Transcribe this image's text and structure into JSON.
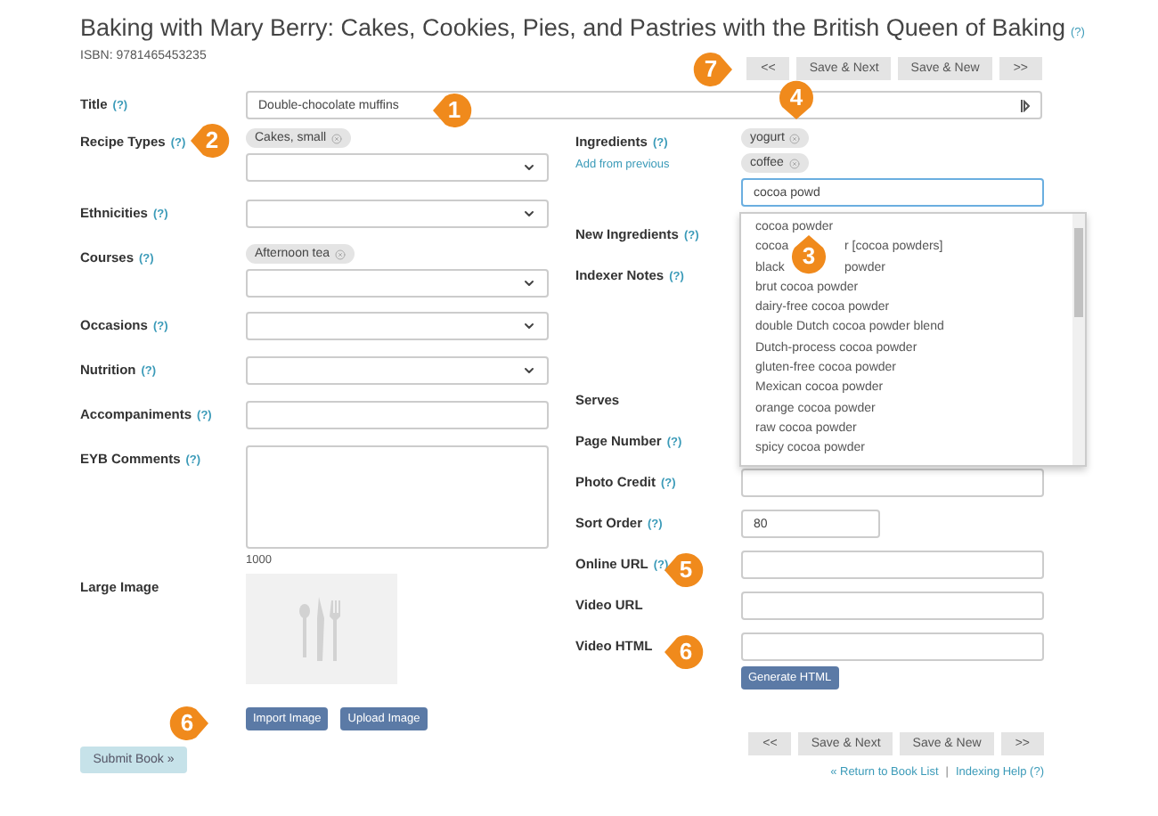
{
  "book": {
    "title": "Baking with Mary Berry: Cakes, Cookies, Pies, and Pastries with the British Queen of Baking",
    "help": "(?)",
    "isbn": "ISBN: 9781465453235"
  },
  "nav_top": [
    "<<",
    "Save & Next",
    "Save & New",
    ">>"
  ],
  "title_field": {
    "label": "Title",
    "help": "(?)",
    "value": "Double-chocolate muffins"
  },
  "left_fields": [
    {
      "kind": "select",
      "label": "Recipe Types",
      "help": "(?)",
      "tags": [
        "Cakes, small"
      ]
    },
    {
      "kind": "select",
      "label": "Ethnicities",
      "help": "(?)"
    },
    {
      "kind": "select",
      "label": "Courses",
      "help": "(?)",
      "tags": [
        "Afternoon tea"
      ]
    },
    {
      "kind": "select",
      "label": "Occasions",
      "help": "(?)"
    },
    {
      "kind": "select",
      "label": "Nutrition",
      "help": "(?)"
    },
    {
      "kind": "text",
      "label": "Accompaniments",
      "help": "(?)"
    },
    {
      "kind": "textarea",
      "label": "EYB Comments",
      "help": "(?)",
      "counter": "1000"
    },
    {
      "kind": "image",
      "label": "Large Image",
      "buttons": [
        "Import Image",
        "Upload Image"
      ]
    }
  ],
  "submit": "Submit Book »",
  "right_fields": [
    {
      "kind": "tags-input",
      "label": "Ingredients",
      "help": "(?)",
      "link": "Add from previous",
      "tags": [
        "yogurt",
        "coffee"
      ],
      "value": "cocoa powd"
    },
    {
      "kind": "covered",
      "label": "New Ingredients",
      "help": "(?)"
    },
    {
      "kind": "covered-tall",
      "label": "Indexer Notes",
      "help": "(?)"
    },
    {
      "kind": "covered",
      "label": "Serves"
    },
    {
      "kind": "covered",
      "label": "Page Number",
      "help": "(?)"
    },
    {
      "kind": "text",
      "label": "Photo Credit",
      "help": "(?)"
    },
    {
      "kind": "short",
      "label": "Sort Order",
      "help": "(?)",
      "value": "80"
    },
    {
      "kind": "text",
      "label": "Online URL",
      "help": "(?)"
    },
    {
      "kind": "text",
      "label": "Video URL"
    },
    {
      "kind": "text",
      "label": "Video HTML",
      "button": "Generate HTML"
    }
  ],
  "suggestions": [
    {
      "parts": [
        "cocoa powder"
      ]
    },
    {
      "parts": [
        "cocoa",
        "r [cocoa powders]"
      ]
    },
    {
      "parts": [
        "black",
        "powder"
      ]
    },
    {
      "parts": [
        "brut cocoa powder"
      ]
    },
    {
      "parts": [
        "dairy-free cocoa powder"
      ]
    },
    {
      "parts": [
        "double Dutch cocoa powder blend"
      ]
    },
    {
      "parts": [
        "Dutch-process cocoa powder"
      ]
    },
    {
      "parts": [
        "gluten-free cocoa powder"
      ]
    },
    {
      "parts": [
        "Mexican cocoa powder"
      ]
    },
    {
      "parts": [
        "orange cocoa powder"
      ]
    },
    {
      "parts": [
        "raw cocoa powder"
      ]
    },
    {
      "parts": [
        "spicy cocoa powder"
      ]
    }
  ],
  "nav_bottom": [
    "<<",
    "Save & Next",
    "Save & New",
    ">>"
  ],
  "footer": {
    "return_link": "« Return to Book List",
    "separator": "|",
    "help_link": "Indexing Help",
    "help": "(?)"
  },
  "callouts": [
    {
      "number": "1",
      "kind": "left"
    },
    {
      "number": "2",
      "kind": "left"
    },
    {
      "number": "3",
      "kind": "up"
    },
    {
      "number": "4",
      "kind": "down"
    },
    {
      "number": "5",
      "kind": "left"
    },
    {
      "number": "6",
      "kind": "left"
    },
    {
      "number": "6",
      "kind": "right"
    },
    {
      "number": "7",
      "kind": "right"
    }
  ]
}
